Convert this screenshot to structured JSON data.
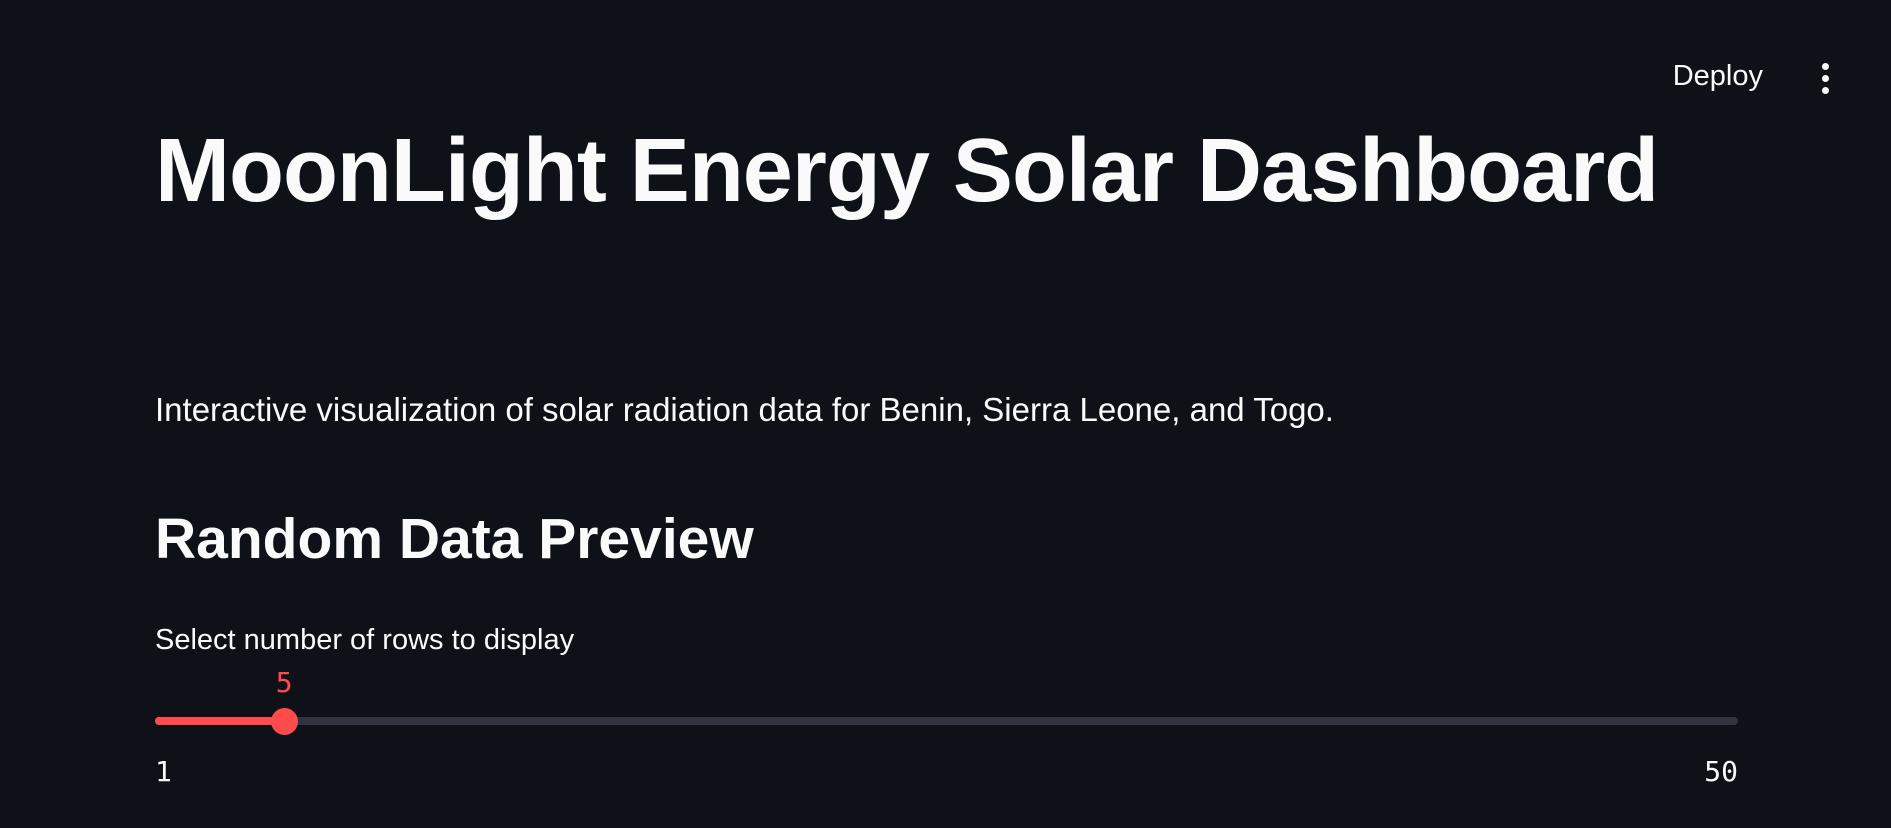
{
  "header": {
    "deploy_label": "Deploy",
    "menu_icon": "vertical-ellipsis-icon"
  },
  "main": {
    "title": "MoonLight Energy Solar Dashboard",
    "description": "Interactive visualization of solar radiation data for Benin, Sierra Leone, and Togo.",
    "section_heading": "Random Data Preview",
    "slider": {
      "label": "Select number of rows to display",
      "value": "5",
      "min": "1",
      "max": "50"
    }
  },
  "colors": {
    "background": "#0e1117",
    "text": "#fafafa",
    "accent": "#ff4b4b",
    "track": "#31333f"
  }
}
